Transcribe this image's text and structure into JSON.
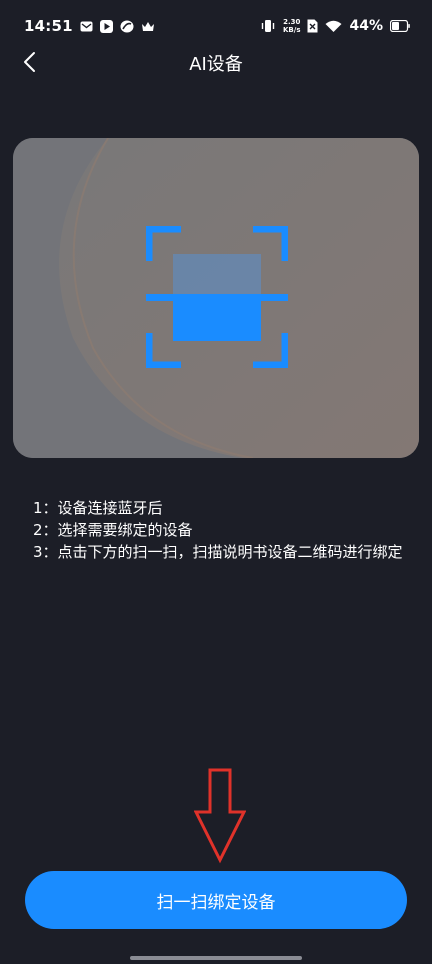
{
  "status_bar": {
    "time": "14:51",
    "net_speed_value": "2.30",
    "net_speed_unit": "KB/s",
    "battery": "44%",
    "icons": [
      "mail-icon",
      "video-app-icon",
      "music-app-icon",
      "crown-icon",
      "vibrate-icon",
      "wifi-icon",
      "sim-off-icon",
      "battery-icon"
    ]
  },
  "header": {
    "title": "AI设备",
    "back_icon": "chevron-left-icon"
  },
  "scan_card": {
    "icon": "scan-frame-icon",
    "accent": "#1a8cff"
  },
  "instructions": [
    "1：设备连接蓝牙后",
    "2：选择需要绑定的设备",
    "3：点击下方的扫一扫，扫描说明书设备二维码进行绑定"
  ],
  "annotation": {
    "icon": "down-arrow-icon",
    "color": "#e0322a"
  },
  "bind_button": {
    "label": "扫一扫绑定设备",
    "color": "#1a8cff"
  }
}
